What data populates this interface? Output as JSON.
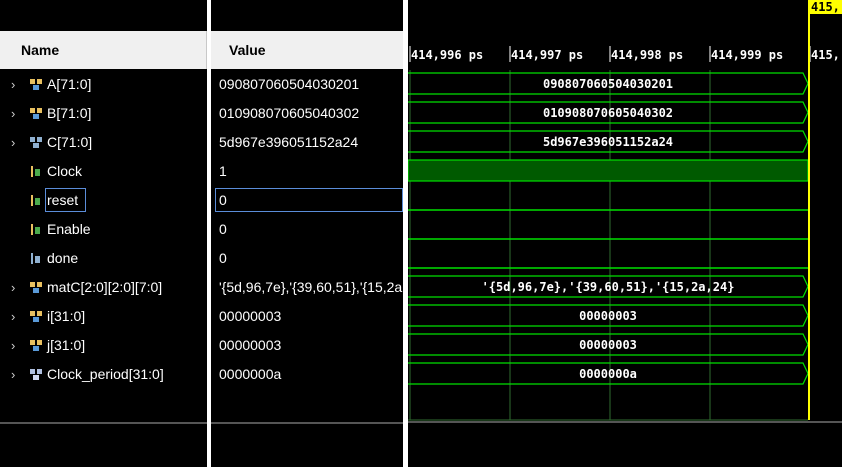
{
  "columns": {
    "name": "Name",
    "value": "Value"
  },
  "signals": [
    {
      "name": "A[71:0]",
      "value": "090807060504030201",
      "expandable": true,
      "icon": "bus-icon",
      "wave": "090807060504030201",
      "kind": "bus"
    },
    {
      "name": "B[71:0]",
      "value": "010908070605040302",
      "expandable": true,
      "icon": "bus-icon",
      "wave": "010908070605040302",
      "kind": "bus"
    },
    {
      "name": "C[71:0]",
      "value": "5d967e396051152a24",
      "expandable": true,
      "icon": "bus-out-icon",
      "wave": "5d967e396051152a24",
      "kind": "bus"
    },
    {
      "name": "Clock",
      "value": "1",
      "expandable": false,
      "icon": "bit-icon",
      "wave": "",
      "kind": "high"
    },
    {
      "name": "reset",
      "value": "0",
      "expandable": false,
      "icon": "bit-icon",
      "wave": "",
      "kind": "low",
      "selected": true
    },
    {
      "name": "Enable",
      "value": "0",
      "expandable": false,
      "icon": "bit-icon",
      "wave": "",
      "kind": "low"
    },
    {
      "name": "done",
      "value": "0",
      "expandable": false,
      "icon": "bit-out-icon",
      "wave": "",
      "kind": "low"
    },
    {
      "name": "matC[2:0][2:0][7:0]",
      "value": "'{5d,96,7e},'{39,60,51},'{15,2a",
      "expandable": true,
      "icon": "bus-icon",
      "wave": "'{5d,96,7e},'{39,60,51},'{15,2a,24}",
      "kind": "bus"
    },
    {
      "name": "i[31:0]",
      "value": "00000003",
      "expandable": true,
      "icon": "bus-icon",
      "wave": "00000003",
      "kind": "bus"
    },
    {
      "name": "j[31:0]",
      "value": "00000003",
      "expandable": true,
      "icon": "bus-icon",
      "wave": "00000003",
      "kind": "bus"
    },
    {
      "name": "Clock_period[31:0]",
      "value": "0000000a",
      "expandable": true,
      "icon": "bus-param-icon",
      "wave": "0000000a",
      "kind": "bus"
    }
  ],
  "timeline": {
    "ticks": [
      "414,996 ps",
      "414,997 ps",
      "414,998 ps",
      "414,999 ps",
      "415,"
    ],
    "cursor_label": "415,"
  },
  "colors": {
    "wave_bus": "#00e000",
    "wave_high_fill": "#005a00",
    "cursor": "#ffff00",
    "grid": "#2f6b2f"
  }
}
